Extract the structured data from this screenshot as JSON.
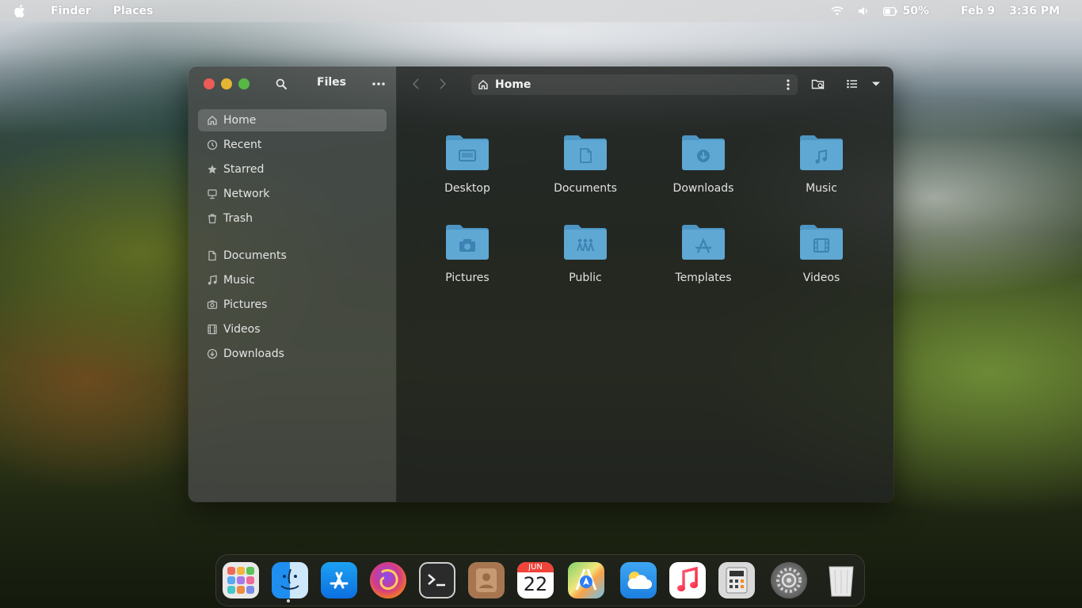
{
  "menubar": {
    "app_name": "Finder",
    "menu": "Places",
    "battery": "50%",
    "date": "Feb 9",
    "time": "3:36 PM"
  },
  "window": {
    "title": "Files",
    "path": "Home",
    "sidebar": {
      "places": [
        {
          "label": "Home",
          "icon": "home-icon",
          "active": true
        },
        {
          "label": "Recent",
          "icon": "clock-icon"
        },
        {
          "label": "Starred",
          "icon": "star-icon"
        },
        {
          "label": "Network",
          "icon": "network-icon"
        },
        {
          "label": "Trash",
          "icon": "trash-icon"
        }
      ],
      "bookmarks": [
        {
          "label": "Documents",
          "icon": "document-icon"
        },
        {
          "label": "Music",
          "icon": "music-icon"
        },
        {
          "label": "Pictures",
          "icon": "camera-icon"
        },
        {
          "label": "Videos",
          "icon": "film-icon"
        },
        {
          "label": "Downloads",
          "icon": "download-icon"
        }
      ]
    },
    "folders": [
      {
        "name": "Desktop",
        "icon": "desktop-folder-icon"
      },
      {
        "name": "Documents",
        "icon": "documents-folder-icon"
      },
      {
        "name": "Downloads",
        "icon": "downloads-folder-icon"
      },
      {
        "name": "Music",
        "icon": "music-folder-icon"
      },
      {
        "name": "Pictures",
        "icon": "pictures-folder-icon"
      },
      {
        "name": "Public",
        "icon": "public-folder-icon"
      },
      {
        "name": "Templates",
        "icon": "templates-folder-icon"
      },
      {
        "name": "Videos",
        "icon": "videos-folder-icon"
      }
    ]
  },
  "dock": {
    "calendar_month": "JUN",
    "calendar_day": "22",
    "apps": [
      "launchpad-icon",
      "finder-icon",
      "app-store-icon",
      "firefox-icon",
      "terminal-icon",
      "contacts-icon",
      "calendar-icon",
      "maps-icon",
      "weather-icon",
      "music-icon",
      "calculator-icon",
      "system-preferences-icon",
      "trash-icon"
    ]
  },
  "colors": {
    "folder": "#5fa8d3",
    "folder_tab": "#4d96c4",
    "close": "#ec5b56",
    "minimize": "#e5b634",
    "maximize": "#57b846"
  }
}
